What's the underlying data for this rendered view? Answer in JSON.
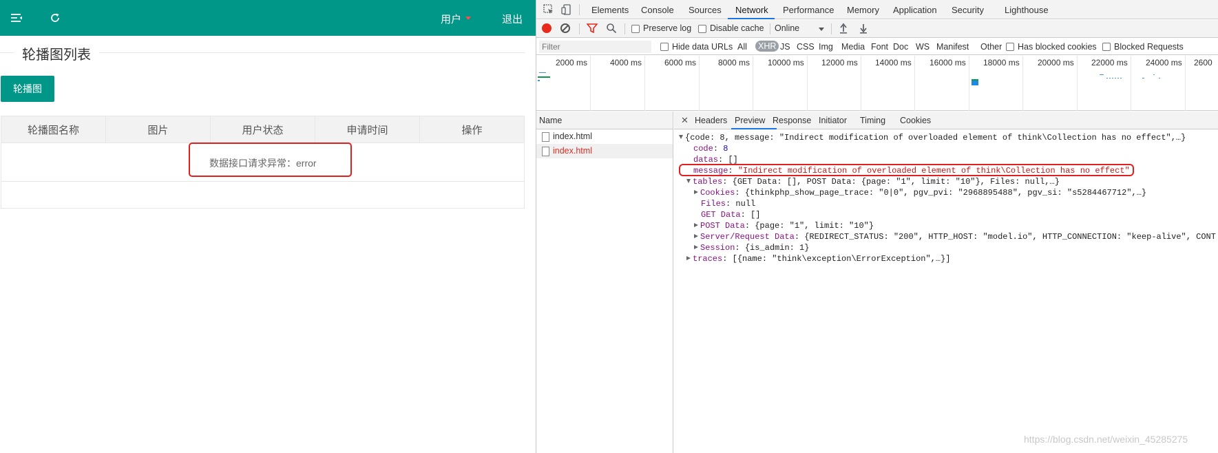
{
  "app": {
    "header": {
      "user_label": "用户",
      "logout_label": "退出",
      "menu_icon": "menu-fold-icon",
      "refresh_icon": "refresh-icon",
      "bg_color": "#009688"
    },
    "section_title": "轮播图列表",
    "add_button_label": "轮播图",
    "table": {
      "columns": [
        "轮播图名称",
        "图片",
        "用户状态",
        "申请时间",
        "操作"
      ],
      "error_message": "数据接口请求异常：error"
    }
  },
  "devtools": {
    "tabs": [
      "Elements",
      "Console",
      "Sources",
      "Network",
      "Performance",
      "Memory",
      "Application",
      "Security",
      "Lighthouse"
    ],
    "active_tab": "Network",
    "toolbar": {
      "preserve_log": "Preserve log",
      "disable_cache": "Disable cache",
      "throttling": "Online"
    },
    "filter": {
      "placeholder": "Filter",
      "hide_data_urls": "Hide data URLs",
      "types": [
        "All",
        "XHR",
        "JS",
        "CSS",
        "Img",
        "Media",
        "Font",
        "Doc",
        "WS",
        "Manifest",
        "Other"
      ],
      "active_type": "XHR",
      "has_blocked_cookies": "Has blocked cookies",
      "blocked_requests": "Blocked Requests"
    },
    "timeline_ticks": [
      "2000 ms",
      "4000 ms",
      "6000 ms",
      "8000 ms",
      "10000 ms",
      "12000 ms",
      "14000 ms",
      "16000 ms",
      "18000 ms",
      "20000 ms",
      "22000 ms",
      "24000 ms",
      "2600"
    ],
    "name_column": {
      "header": "Name",
      "requests": [
        "index.html",
        "index.html"
      ]
    },
    "detail_tabs": [
      "Headers",
      "Preview",
      "Response",
      "Initiator",
      "Timing",
      "Cookies"
    ],
    "active_detail_tab": "Preview",
    "preview": {
      "root_summary": "{code: 8, message: \"Indirect modification of overloaded element of think\\Collection has no effect\",…}",
      "code_key": "code",
      "code_value": "8",
      "datas_key": "datas",
      "datas_value": "[]",
      "message_key": "message",
      "message_value": "\"Indirect modification of overloaded element of think\\Collection has no effect\"",
      "tables_key": "tables",
      "tables_summary": "{GET Data: [], POST Data: {page: \"1\", limit: \"10\"}, Files: null,…}",
      "cookies_key": "Cookies",
      "cookies_summary": "{thinkphp_show_page_trace: \"0|0\", pgv_pvi: \"2968895488\", pgv_si: \"s5284467712\",…}",
      "files_key": "Files",
      "files_value": "null",
      "get_key": "GET Data",
      "get_value": "[]",
      "post_key": "POST Data",
      "post_summary": "{page: \"1\", limit: \"10\"}",
      "server_key": "Server/Request Data",
      "server_summary": "{REDIRECT_STATUS: \"200\", HTTP_HOST: \"model.io\", HTTP_CONNECTION: \"keep-alive\", CONT",
      "session_key": "Session",
      "session_summary": "{is_admin: 1}",
      "traces_key": "traces",
      "traces_summary": "[{name: \"think\\exception\\ErrorException\",…}]"
    }
  },
  "watermark": "https://blog.csdn.net/weixin_45285275"
}
